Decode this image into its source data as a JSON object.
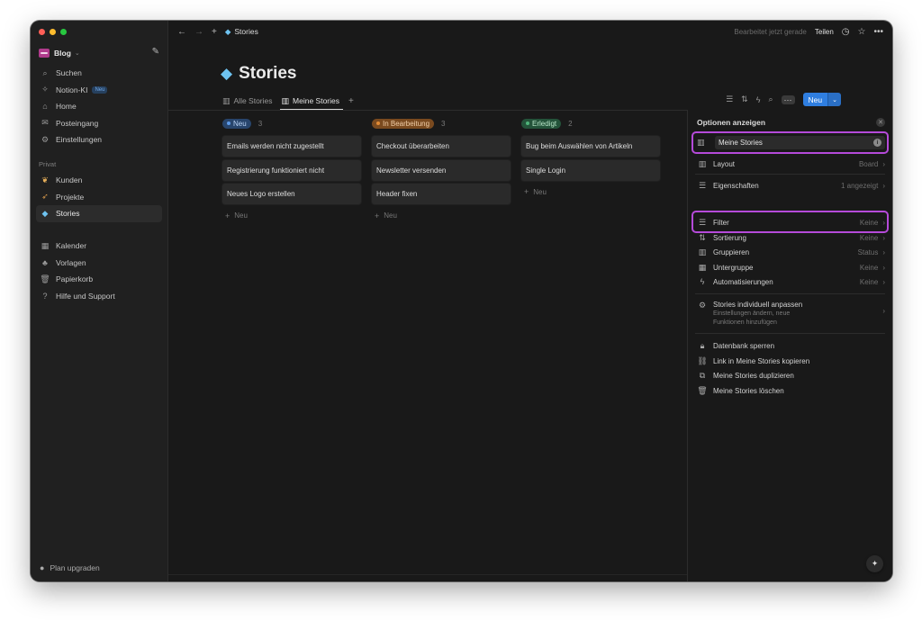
{
  "colors": {
    "traffic_close": "#ff5f57",
    "traffic_min": "#febc2e",
    "traffic_max": "#28c840",
    "accent_blue": "#2f7ee0",
    "highlight": "#b54ad9",
    "status_new_bg": "#28456c",
    "status_new_fg": "#b9d3f5",
    "status_new_dot": "#5d9ae8",
    "status_progress_bg": "#7a4a1f",
    "status_progress_fg": "#f1cfa8",
    "status_progress_dot": "#e08a35",
    "status_done_bg": "#24533a",
    "status_done_fg": "#b7e4c7",
    "status_done_dot": "#4fb37a"
  },
  "sidebar": {
    "workspace": "Blog",
    "nav": [
      {
        "label": "Suchen",
        "icon": "search-icon"
      },
      {
        "label": "Notion-KI",
        "icon": "sparkle-icon",
        "badge": "Neu"
      },
      {
        "label": "Home",
        "icon": "home-icon"
      },
      {
        "label": "Posteingang",
        "icon": "inbox-icon"
      },
      {
        "label": "Einstellungen",
        "icon": "gear-icon"
      }
    ],
    "private_label": "Privat",
    "private": [
      {
        "label": "Kunden",
        "icon": "handshake-icon"
      },
      {
        "label": "Projekte",
        "icon": "rocket-icon"
      },
      {
        "label": "Stories",
        "icon": "gem-icon"
      }
    ],
    "tools": [
      {
        "label": "Kalender",
        "icon": "calendar-icon"
      },
      {
        "label": "Vorlagen",
        "icon": "shapes-icon"
      },
      {
        "label": "Papierkorb",
        "icon": "trash-icon"
      },
      {
        "label": "Hilfe und Support",
        "icon": "help-icon"
      }
    ],
    "plan": "Plan upgraden"
  },
  "topbar": {
    "breadcrumb": "Stories",
    "edited": "Bearbeitet jetzt gerade",
    "share": "Teilen"
  },
  "page": {
    "title": "Stories",
    "tabs": [
      "Alle Stories",
      "Meine Stories"
    ],
    "new_button": "Neu"
  },
  "board": {
    "columns": [
      {
        "status": "Neu",
        "count": "3",
        "cards": [
          "Emails werden nicht zugestellt",
          "Registrierung funktioniert nicht",
          "Neues Logo erstellen"
        ],
        "add": "Neu"
      },
      {
        "status": "In Bearbeitung",
        "count": "3",
        "cards": [
          "Checkout überarbeiten",
          "Newsletter versenden",
          "Header fixen"
        ],
        "add": "Neu"
      },
      {
        "status": "Erledigt",
        "count": "2",
        "cards": [
          "Bug beim Auswählen von Artikeln",
          "Single Login"
        ],
        "add": "Neu"
      }
    ]
  },
  "panel": {
    "title": "Optionen anzeigen",
    "view_name": "Meine Stories",
    "rows": [
      {
        "label": "Layout",
        "value": "Board"
      },
      {
        "label": "Eigenschaften",
        "value": "1 angezeigt"
      },
      {
        "label": "Filter",
        "value": "Keine"
      },
      {
        "label": "Sortierung",
        "value": "Keine"
      },
      {
        "label": "Gruppieren",
        "value": "Status"
      },
      {
        "label": "Untergruppe",
        "value": "Keine"
      },
      {
        "label": "Automatisierungen",
        "value": "Keine"
      }
    ],
    "customize_title": "Stories individuell anpassen",
    "customize_desc_1": "Einstellungen ändern, neue",
    "customize_desc_2": "Funktionen hinzufügen",
    "actions": [
      "Datenbank sperren",
      "Link in Meine Stories kopieren",
      "Meine Stories duplizieren",
      "Meine Stories löschen"
    ]
  }
}
